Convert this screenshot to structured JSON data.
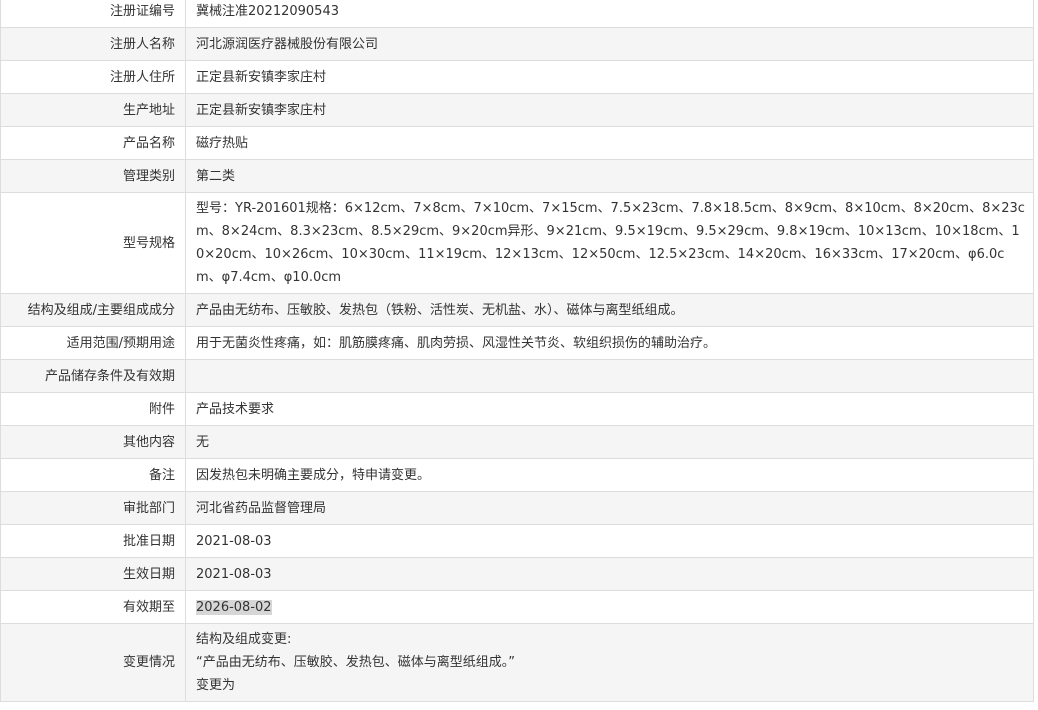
{
  "rows": [
    {
      "label": "注册证编号",
      "value": "冀械注准20212090543"
    },
    {
      "label": "注册人名称",
      "value": "河北源润医疗器械股份有限公司"
    },
    {
      "label": "注册人住所",
      "value": "正定县新安镇李家庄村"
    },
    {
      "label": "生产地址",
      "value": "正定县新安镇李家庄村"
    },
    {
      "label": "产品名称",
      "value": "磁疗热贴"
    },
    {
      "label": "管理类别",
      "value": "第二类"
    },
    {
      "label": "型号规格",
      "value": "型号：YR-201601规格：6×12cm、7×8cm、7×10cm、7×15cm、7.5×23cm、7.8×18.5cm、8×9cm、8×10cm、8×20cm、8×23cm、8×24cm、8.3×23cm、8.5×29cm、9×20cm异形、9×21cm、9.5×19cm、9.5×29cm、9.8×19cm、10×13cm、10×18cm、10×20cm、10×26cm、10×30cm、11×19cm、12×13cm、12×50cm、12.5×23cm、14×20cm、16×33cm、17×20cm、φ6.0cm、φ7.4cm、φ10.0cm"
    },
    {
      "label": "结构及组成/主要组成成分",
      "value": "产品由无纺布、压敏胶、发热包（铁粉、活性炭、无机盐、水）、磁体与离型纸组成。"
    },
    {
      "label": "适用范围/预期用途",
      "value": "用于无菌炎性疼痛，如：肌筋膜疼痛、肌肉劳损、风湿性关节炎、软组织损伤的辅助治疗。"
    },
    {
      "label": "产品储存条件及有效期",
      "value": ""
    },
    {
      "label": "附件",
      "value": "产品技术要求"
    },
    {
      "label": "其他内容",
      "value": "无"
    },
    {
      "label": "备注",
      "value": "因发热包未明确主要成分，特申请变更。"
    },
    {
      "label": "审批部门",
      "value": "河北省药品监督管理局"
    },
    {
      "label": "批准日期",
      "value": "2021-08-03"
    },
    {
      "label": "生效日期",
      "value": "2021-08-03"
    },
    {
      "label": "有效期至",
      "value": "2026-08-02"
    },
    {
      "label": "变更情况",
      "lines": [
        "结构及组成变更:",
        "“产品由无纺布、压敏胶、发热包、磁体与离型纸组成。”",
        "变更为"
      ]
    }
  ]
}
